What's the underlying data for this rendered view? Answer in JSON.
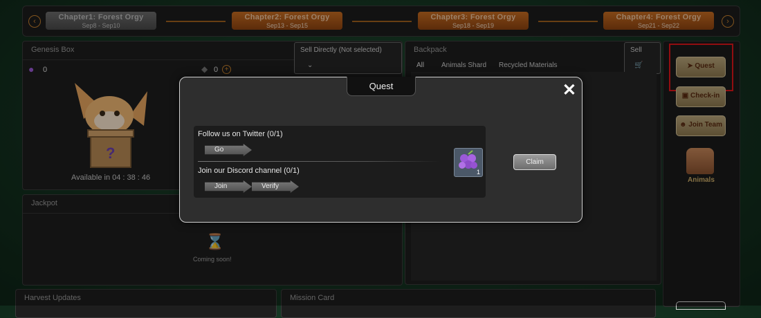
{
  "chapters": [
    {
      "title": "Chapter1: Forest Orgy",
      "dates": "Sep8 - Sep10"
    },
    {
      "title": "Chapter2: Forest Orgy",
      "dates": "Sep13 - Sep15"
    },
    {
      "title": "Chapter3: Forest Orgy",
      "dates": "Sep18 - Sep19"
    },
    {
      "title": "Chapter4: Forest Orgy",
      "dates": "Sep21 - Sep22"
    }
  ],
  "genesis": {
    "title": "Genesis Box",
    "grape_count": "0",
    "gem_count": "0",
    "sell_select": "Sell Directly (Not selected)",
    "countdown": "Available in 04 : 38 : 46"
  },
  "backpack": {
    "title": "Backpack",
    "sell_label": "Sell",
    "tabs": [
      "All",
      "Animals Shard",
      "Recycled Materials"
    ]
  },
  "jackpot": {
    "title": "Jackpot",
    "coming_soon": "Coming soon!"
  },
  "harvest": {
    "title": "Harvest Updates"
  },
  "mission": {
    "title": "Mission Card"
  },
  "sidebar": {
    "quest": "Quest",
    "checkin": "Check-in",
    "join_team": "Join Team",
    "animals": "Animals"
  },
  "modal": {
    "title": "Quest",
    "twitter": "Follow us on Twitter (0/1)",
    "go": "Go",
    "discord": "Join our Discord channel (0/1)",
    "join": "Join",
    "verify": "Verify",
    "reward_count": "1",
    "claim": "Claim"
  },
  "colors": {
    "accent_orange": "#c86d22",
    "highlight_red": "#e0141a",
    "button_tan": "#b9a57a"
  }
}
